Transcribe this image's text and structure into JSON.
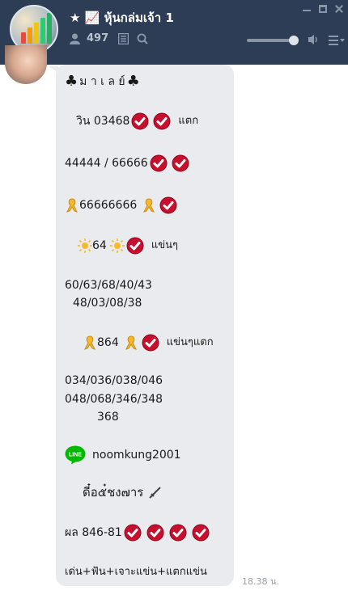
{
  "chat": {
    "title": "★ 📈 หุ้นกล่มเจ้า 1",
    "member_count": "497"
  },
  "message": {
    "lines": {
      "l0_text": "ม า เ ล ย์",
      "l1_prefix": "วิน 03468",
      "l1_suffix": "แตก",
      "l2_text": "44444 / 66666",
      "l3_text": "66666666",
      "l4_text": "64",
      "l4_suffix": "แข่นๆ",
      "l5a": "60/63/68/40/43",
      "l5b": "48/03/08/38",
      "l6_text": "864",
      "l6_suffix": "แข่นๆแตก",
      "l7a": "034/036/038/046",
      "l7b": "048/068/346/348",
      "l7c": "368",
      "l8_text": "noomkung2001",
      "l9_text": "ดี๋อ๕๋ชง๗าร",
      "l10_text": "ผล 846-81",
      "l11_text": "เด่น+ฟัน+เจาะแข่น+แตกแข่น"
    },
    "line_logo_text": "LINE",
    "timestamp": "18.38 น."
  },
  "icons": {
    "check": "red-check-circle-icon",
    "ribbon": "gold-ribbon-icon",
    "sun": "sun-icon",
    "club": "club-suit-icon",
    "dagger": "dagger-icon"
  },
  "colors": {
    "header_bg": "#2d3d55",
    "bubble_bg": "#e9ebee",
    "check_red": "#c8102e"
  }
}
